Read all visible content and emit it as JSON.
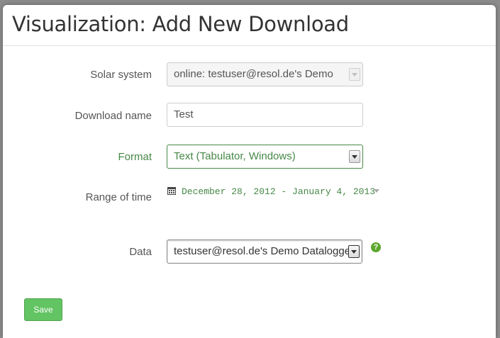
{
  "modal": {
    "title": "Visualization: Add New Download"
  },
  "form": {
    "solar_system": {
      "label": "Solar system",
      "value": "online:  testuser@resol.de's Demo"
    },
    "download_name": {
      "label": "Download name",
      "value": "Test"
    },
    "format": {
      "label": "Format",
      "value": "Text (Tabulator, Windows)"
    },
    "range": {
      "label": "Range of time",
      "value": "December 28, 2012 - January 4, 2013"
    },
    "data": {
      "label": "Data",
      "value": "testuser@resol.de's Demo Datalogger"
    }
  },
  "actions": {
    "save_label": "Save"
  },
  "colors": {
    "success": "#468847",
    "save_button": "#62c462",
    "help_icon": "#5ba62b"
  },
  "icons": [
    "calendar-icon",
    "chevron-down-icon",
    "help-icon"
  ]
}
